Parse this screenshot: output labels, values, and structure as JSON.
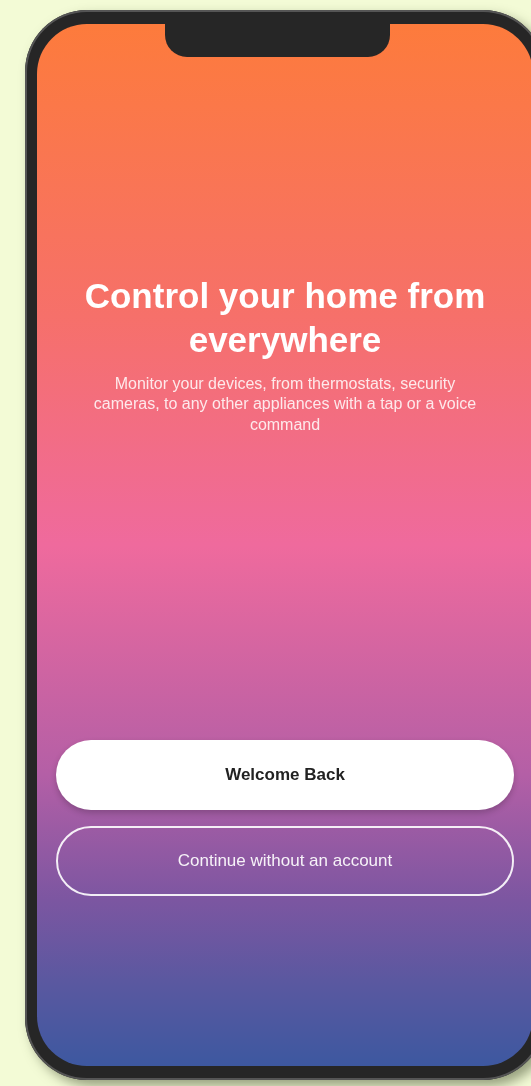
{
  "onboarding": {
    "title": "Control your home from everywhere",
    "subtitle": "Monitor your devices, from thermostats, security cameras, to any other appliances with a tap or a voice command"
  },
  "buttons": [
    {
      "label": "Welcome Back",
      "kind": "filled"
    },
    {
      "label": "Continue without an account",
      "kind": "outline"
    }
  ]
}
